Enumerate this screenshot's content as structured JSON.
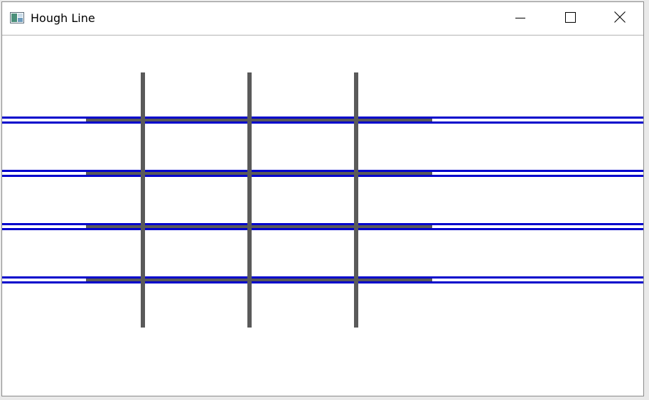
{
  "window": {
    "title": "Hough Line",
    "app_icon": "opencv-window-icon",
    "controls": {
      "minimize_icon": "minimize-icon",
      "maximize_icon": "maximize-icon",
      "close_icon": "close-icon"
    }
  },
  "colors": {
    "title_bar": "#ffffff",
    "canvas_background": "#ffffff",
    "source_line": "#5a5a5a",
    "detected_line": "#0000cc"
  },
  "image": {
    "source_vertical_line_count": 3,
    "source_horizontal_line_count": 4,
    "detected_line_pair_count": 4
  }
}
